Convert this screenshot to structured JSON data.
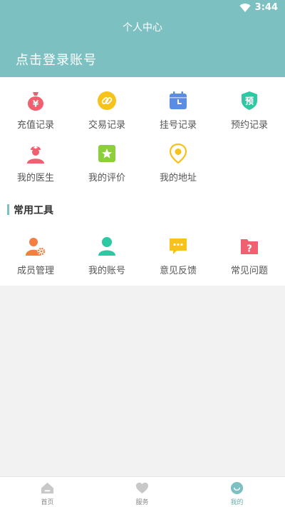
{
  "status_bar": {
    "time": "3:44",
    "wifi_icon": "wifi-icon"
  },
  "header": {
    "title": "个人中心",
    "login_label": "点击登录账号",
    "bg_color": "#7cc0c2"
  },
  "menu": [
    {
      "label": "充值记录",
      "icon": "money-bag-icon",
      "color": "#f06070"
    },
    {
      "label": "交易记录",
      "icon": "link-icon",
      "color": "#f7c21a"
    },
    {
      "label": "挂号记录",
      "icon": "calendar-icon",
      "color": "#5a8ce6"
    },
    {
      "label": "预约记录",
      "icon": "shield-icon",
      "color": "#2cc9a2",
      "badge": "预"
    },
    {
      "label": "我的医生",
      "icon": "doctor-icon",
      "color": "#f06070"
    },
    {
      "label": "我的评价",
      "icon": "star-icon",
      "color": "#8dcf3a"
    },
    {
      "label": "我的地址",
      "icon": "location-pin-icon",
      "color": "#f7c21a"
    }
  ],
  "tools": {
    "title": "常用工具",
    "items": [
      {
        "label": "成员管理",
        "icon": "user-settings-icon",
        "color": "#f27e3f"
      },
      {
        "label": "我的账号",
        "icon": "user-icon",
        "color": "#2cc9a2"
      },
      {
        "label": "意见反馈",
        "icon": "chat-icon",
        "color": "#f7c21a"
      },
      {
        "label": "常见问题",
        "icon": "help-folder-icon",
        "color": "#f06070"
      }
    ]
  },
  "tabbar": [
    {
      "label": "首页",
      "icon": "home-icon",
      "active": false
    },
    {
      "label": "服务",
      "icon": "heart-icon",
      "active": false
    },
    {
      "label": "我的",
      "icon": "smile-icon",
      "active": true
    }
  ]
}
